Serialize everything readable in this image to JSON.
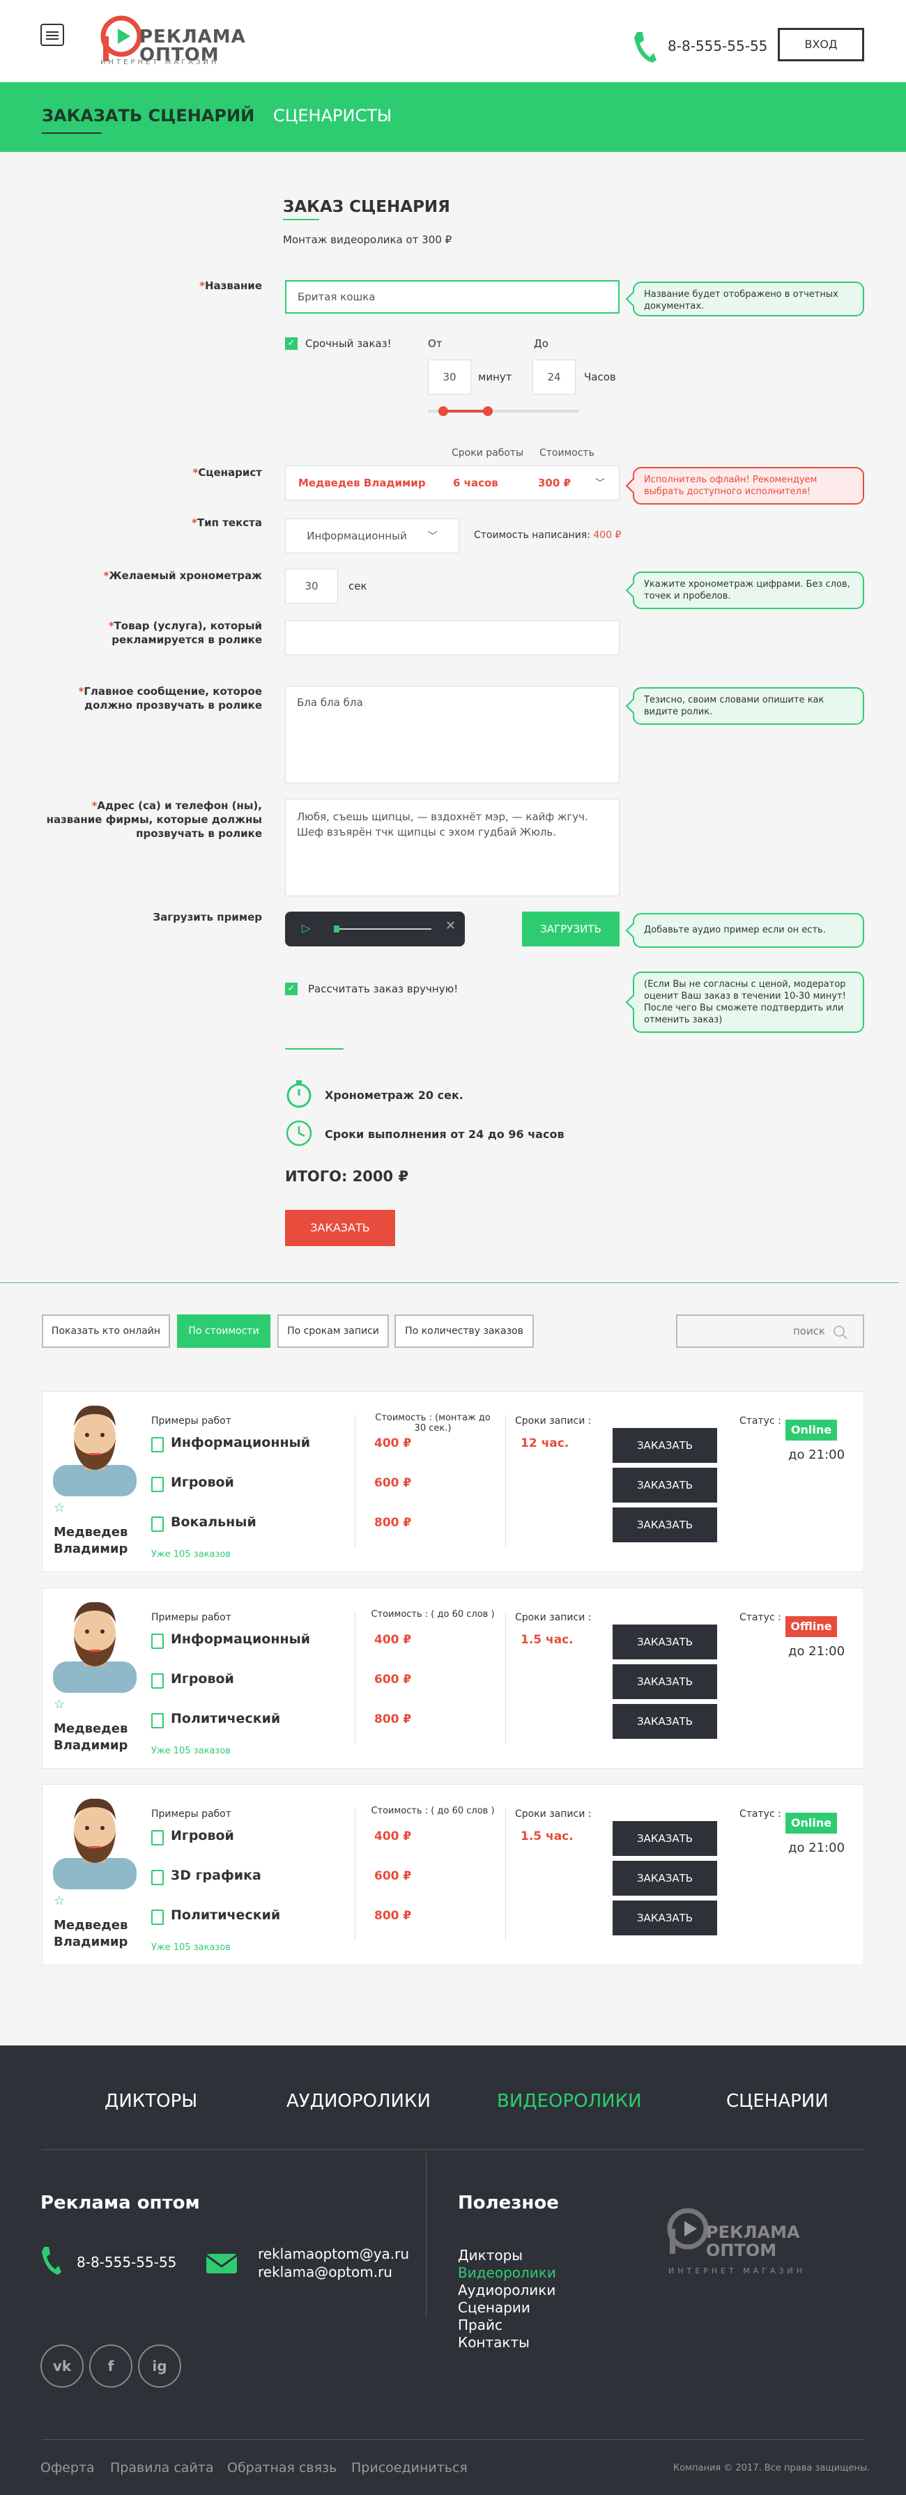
{
  "header": {
    "logo_main": "РЕКЛАМА ОПТОМ",
    "logo_sub": "ИНТЕРНЕТ МАГАЗИН",
    "phone": "8-8-555-55-55",
    "login": "ВХОД"
  },
  "nav": {
    "items": [
      "ЗАКАЗАТЬ СЦЕНАРИЙ",
      "СЦЕНАРИСТЫ"
    ]
  },
  "form": {
    "title": "ЗАКАЗ СЦЕНАРИЯ",
    "subtitle": "Монтаж видеоролика от 300 ₽",
    "name_label": "Название",
    "name_value": "Бритая кошка",
    "name_tip": "Название будет отображено в отчетных документах.",
    "urgent_label": "Срочный заказ!",
    "from_label": "От",
    "to_label": "До",
    "from_value": "30",
    "from_unit": "минут",
    "to_value": "24",
    "to_unit": "Часов",
    "slider_range": [
      0.1,
      0.4
    ],
    "writer_col_time": "Сроки работы",
    "writer_col_price": "Стоимость",
    "writer_label": "Сценарист",
    "writer_name": "Медведев Владимир",
    "writer_time": "6 часов",
    "writer_price": "300 ₽",
    "writer_tip": "Исполнитель офлайн! Рекомендуем выбрать доступного исполнителя!",
    "type_label": "Тип текста",
    "type_value": "Информационный",
    "type_cost_label": "Стоимость написания:",
    "type_cost_value": "400 ₽",
    "duration_label": "Желаемый хронометраж",
    "duration_value": "30",
    "duration_unit": "сек",
    "duration_tip": "Укажите хронометраж цифрами. Без слов, точек и пробелов.",
    "product_label": "Товар (услуга), который рекламируется в ролике",
    "message_label": "Главное сообщение, которое должно прозвучать в ролике",
    "message_value": "Бла бла бла",
    "message_tip": "Тезисно, своим словами опишите как видите ролик.",
    "address_label": "Адрес (са) и телефон (ны), название фирмы, которые должны прозвучать в ролике",
    "address_value": "Любя, съешь щипцы, — вздохнёт мэр, — кайф жгуч. Шеф взъярён тчк щипцы с эхом гудбай Жюль.",
    "upload_label": "Загрузить пример",
    "upload_button": "ЗАГРУЗИТЬ",
    "upload_tip": "Добавьте аудио пример если он есть.",
    "manual_label": "Рассчитать заказ вручную!",
    "manual_tip": "(Если Вы не согласны с ценой, модератор оценит Ваш заказ в течении 10-30 минут! После чего Вы сможете подтвердить или отменить заказ)",
    "summary_duration": "Хронометраж 20 сек.",
    "summary_terms": "Сроки выполнения от 24 до 96 часов",
    "total": "ИТОГО: 2000 ₽",
    "order_button": "ЗАКАЗАТЬ"
  },
  "filters": {
    "buttons": [
      "Показать кто онлайн",
      "По стоимости",
      "По срокам записи",
      "По количеству заказов"
    ],
    "search_placeholder": "поиск"
  },
  "cards": [
    {
      "name": "Медведев Владимир",
      "examples_label": "Примеры работ",
      "items": [
        "Информационный",
        "Игровой",
        "Вокальный"
      ],
      "cost_label": "Стоимость : (монтаж до 30 сек.)",
      "prices": [
        "400 ₽",
        "600 ₽",
        "800 ₽"
      ],
      "terms_label": "Сроки записи :",
      "terms": "12 час.",
      "orders": "Уже 105 заказов",
      "order_button": "ЗАКАЗАТЬ",
      "status_label": "Статус :",
      "status": "Online",
      "status_color": "#2ecc71",
      "until": "до 21:00"
    },
    {
      "name": "Медведев Владимир",
      "examples_label": "Примеры работ",
      "items": [
        "Информационный",
        "Игровой",
        "Политический"
      ],
      "cost_label": "Стоимость : ( до 60 слов )",
      "prices": [
        "400 ₽",
        "600 ₽",
        "800 ₽"
      ],
      "terms_label": "Сроки записи :",
      "terms": "1.5 час.",
      "orders": "Уже 105 заказов",
      "order_button": "ЗАКАЗАТЬ",
      "status_label": "Статус :",
      "status": "Offline",
      "status_color": "#e74c3c",
      "until": "до 21:00"
    },
    {
      "name": "Медведев Владимир",
      "examples_label": "Примеры работ",
      "items": [
        "Игровой",
        "3D графика",
        "Политический"
      ],
      "cost_label": "Стоимость : ( до 60 слов )",
      "prices": [
        "400 ₽",
        "600 ₽",
        "800 ₽"
      ],
      "terms_label": "Сроки записи :",
      "terms": "1.5 час.",
      "orders": "Уже 105 заказов",
      "order_button": "ЗАКАЗАТЬ",
      "status_label": "Статус :",
      "status": "Online",
      "status_color": "#2ecc71",
      "until": "до 21:00"
    }
  ],
  "footer": {
    "nav": [
      "ДИКТОРЫ",
      "АУДИОРОЛИКИ",
      "ВИДЕОРОЛИКИ",
      "СЦЕНАРИИ"
    ],
    "company": "Реклама оптом",
    "phone": "8-8-555-55-55",
    "email1": "reklamaoptom@ya.ru",
    "email2": "reklama@optom.ru",
    "useful_title": "Полезное",
    "useful_links": [
      "Дикторы",
      "Видеоролики",
      "Аудиоролики",
      "Сценарии",
      "Прайс",
      "Контакты"
    ],
    "logo_main": "РЕКЛАМА ОПТОМ",
    "logo_sub": "ИНТЕРНЕТ МАГАЗИН",
    "social": [
      "vk",
      "f",
      "ig"
    ],
    "bottom_links": [
      "Оферта",
      "Правила сайта",
      "Обратная связь",
      "Присоединиться"
    ],
    "copyright": "Компания © 2017. Все права защищены."
  },
  "colors": {
    "accent": "#2ecc71",
    "danger": "#e74c3c",
    "dark": "#2e3238"
  }
}
